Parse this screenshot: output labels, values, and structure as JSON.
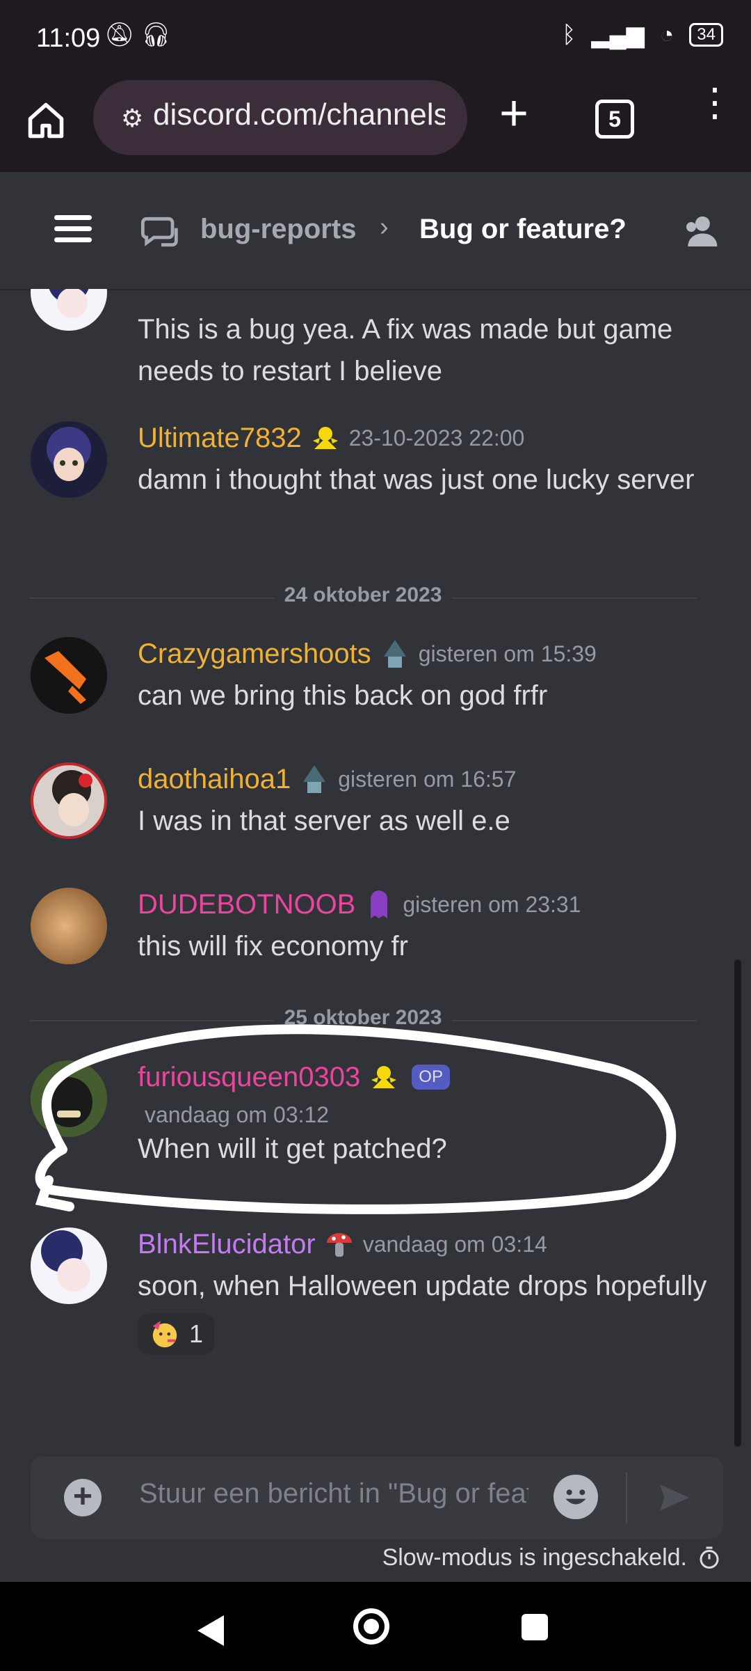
{
  "status_bar": {
    "time": "11:09",
    "battery": "34"
  },
  "browser": {
    "url": "discord.com/channels",
    "tab_count": "5"
  },
  "header": {
    "parent_channel": "bug-reports",
    "separator": "›",
    "thread_title": "Bug or feature?"
  },
  "messages": [
    {
      "username": "",
      "timestamp": "",
      "text": "This is a bug yea. A fix was made but game needs to restart I believe",
      "name_color": "#dbdee1"
    },
    {
      "username": "Ultimate7832",
      "timestamp": "23-10-2023 22:00",
      "text": "damn i thought that was just one lucky server",
      "name_color": "#f0b232"
    },
    {
      "username": "Crazygamershoots",
      "timestamp": "gisteren om 15:39",
      "text": "can we bring this back on god frfr",
      "name_color": "#f0b232"
    },
    {
      "username": "daothaihoa1",
      "timestamp": "gisteren om 16:57",
      "text": "I was in that server as well e.e",
      "name_color": "#f0b232"
    },
    {
      "username": "DUDEBOTNOOB",
      "timestamp": "gisteren om 23:31",
      "text": "this will fix economy fr",
      "name_color": "#eb459e"
    },
    {
      "username": "furiousqueen0303",
      "badge": "OP",
      "timestamp": "vandaag om 03:12",
      "text": "When will it get patched?",
      "name_color": "#eb459e"
    },
    {
      "username": "BlnkElucidator",
      "timestamp": "vandaag om 03:14",
      "text": "soon, when Halloween update drops hopefully",
      "name_color": "#c27bf0",
      "reaction": {
        "emoji": "party-face",
        "count": "1"
      }
    }
  ],
  "dividers": [
    "24 oktober 2023",
    "25 oktober 2023"
  ],
  "composer": {
    "placeholder": "Stuur een bericht in \"Bug or feature?\""
  },
  "slowmode_text": "Slow-modus is ingeschakeld."
}
